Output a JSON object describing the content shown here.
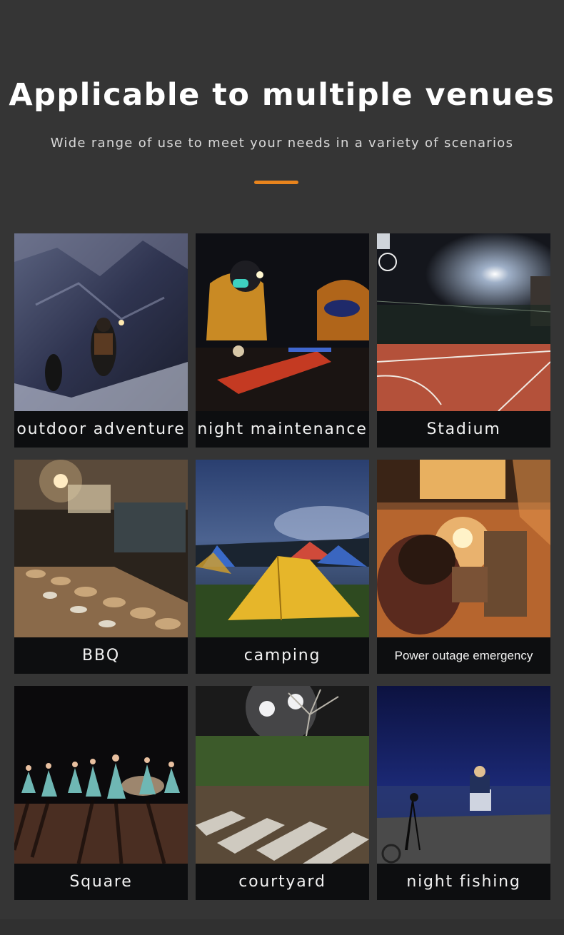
{
  "header": {
    "title": "Applicable to multiple venues",
    "subtitle": "Wide range of use to meet your needs in a variety of scenarios"
  },
  "colors": {
    "background": "#353535",
    "accent": "#e8841d",
    "caption_bg": "#0d0e10"
  },
  "scenarios": [
    {
      "label": "outdoor adventure",
      "image": "cave-explorers-photo"
    },
    {
      "label": "night maintenance",
      "image": "headlamp-workers-photo"
    },
    {
      "label": "Stadium",
      "image": "basketball-court-photo"
    },
    {
      "label": "BBQ",
      "image": "night-food-stall-photo"
    },
    {
      "label": "camping",
      "image": "tent-campsite-photo"
    },
    {
      "label": "Power outage emergency",
      "image": "lamp-lit-room-photo"
    },
    {
      "label": "Square",
      "image": "night-dancers-photo"
    },
    {
      "label": "courtyard",
      "image": "garden-path-lights-photo"
    },
    {
      "label": "night fishing",
      "image": "lakeside-fishing-photo"
    }
  ]
}
